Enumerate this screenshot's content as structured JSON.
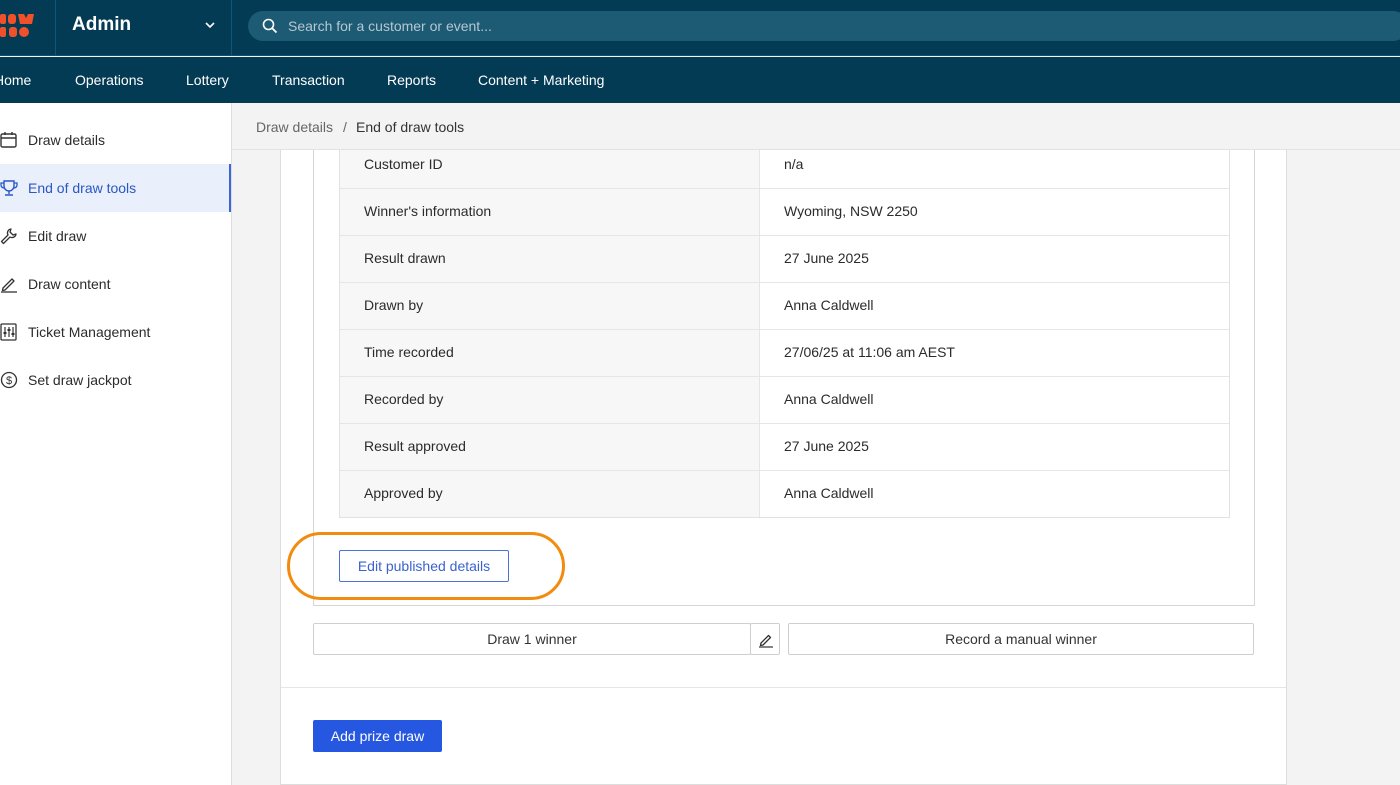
{
  "header": {
    "app_name": "Admin",
    "search": {
      "placeholder": "Search for a customer or event..."
    }
  },
  "nav": {
    "items": [
      "Home",
      "Operations",
      "Lottery",
      "Transaction",
      "Reports",
      "Content + Marketing"
    ]
  },
  "sidebar": {
    "items": [
      {
        "label": "Draw details",
        "icon": "calendar-icon",
        "active": false
      },
      {
        "label": "End of draw tools",
        "icon": "trophy-icon",
        "active": true
      },
      {
        "label": "Edit draw",
        "icon": "wrench-icon",
        "active": false
      },
      {
        "label": "Draw content",
        "icon": "pen-icon",
        "active": false
      },
      {
        "label": "Ticket Management",
        "icon": "sliders-icon",
        "active": false
      },
      {
        "label": "Set draw jackpot",
        "icon": "dollar-icon",
        "active": false
      }
    ]
  },
  "breadcrumb": {
    "parent": "Draw details",
    "separator": "/",
    "current": "End of draw tools"
  },
  "details": {
    "rows": [
      {
        "label": "Customer ID",
        "value": "n/a"
      },
      {
        "label": "Winner's information",
        "value": "Wyoming, NSW 2250"
      },
      {
        "label": "Result drawn",
        "value": "27 June 2025"
      },
      {
        "label": "Drawn by",
        "value": "Anna Caldwell"
      },
      {
        "label": "Time recorded",
        "value": "27/06/25 at 11:06 am AEST"
      },
      {
        "label": "Recorded by",
        "value": "Anna Caldwell"
      },
      {
        "label": "Result approved",
        "value": "27 June 2025"
      },
      {
        "label": "Approved by",
        "value": "Anna Caldwell"
      }
    ]
  },
  "actions": {
    "edit_published": "Edit published details",
    "draw_winner": "Draw 1 winner",
    "record_manual": "Record a manual winner",
    "add_prize_draw": "Add prize draw"
  },
  "colors": {
    "topbar": "#043b54",
    "accent": "#2657e0",
    "highlight": "#f28c0f",
    "logo": "#f0502a"
  }
}
